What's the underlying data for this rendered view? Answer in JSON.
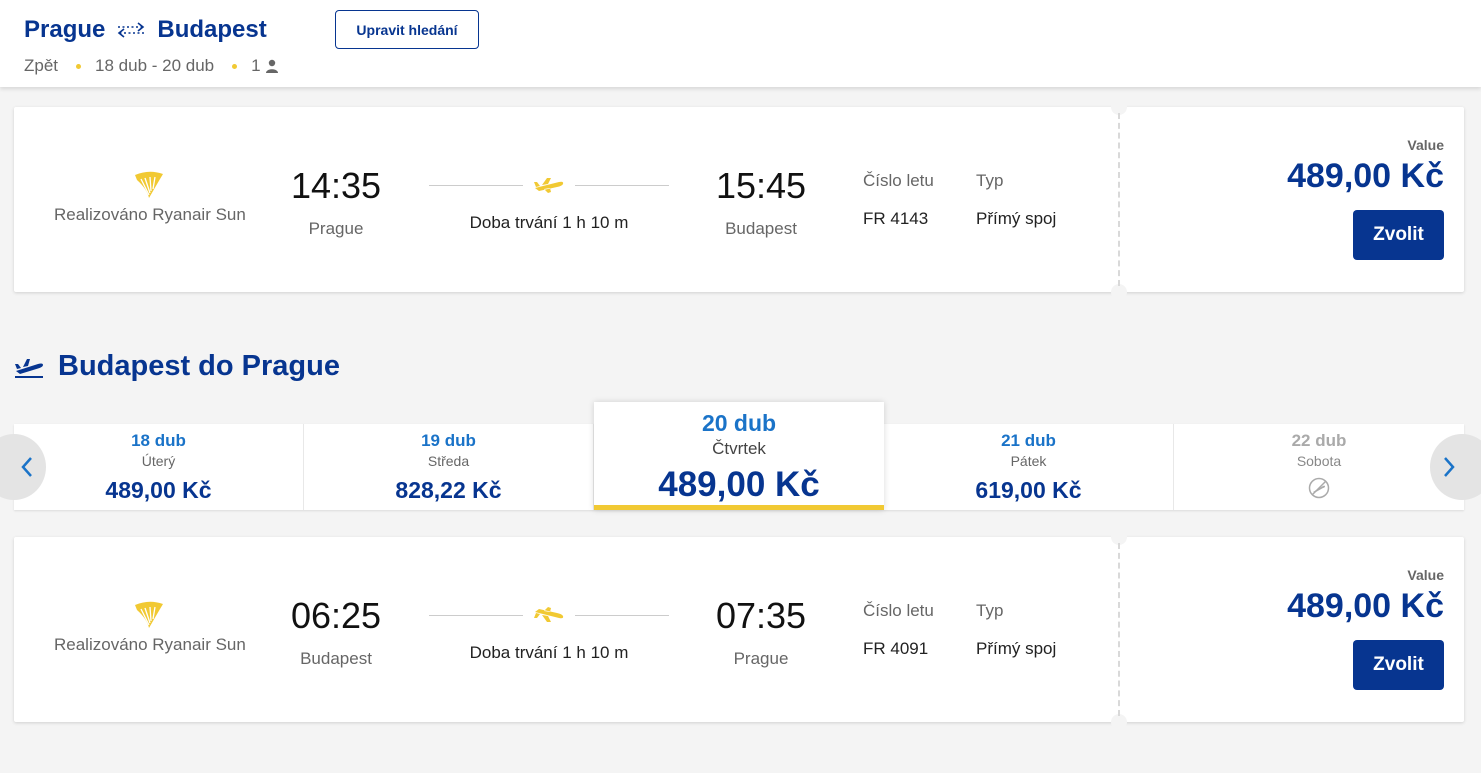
{
  "header": {
    "origin": "Prague",
    "destination": "Budapest",
    "back_label": "Zpět",
    "dates": "18 dub - 20 dub",
    "passengers": "1",
    "edit_button": "Upravit hledání"
  },
  "outbound_flight": {
    "operator": "Realizováno Ryanair Sun",
    "departure_time": "14:35",
    "departure_city": "Prague",
    "duration": "Doba trvání 1 h 10 m",
    "arrival_time": "15:45",
    "arrival_city": "Budapest",
    "flight_number_label": "Číslo letu",
    "flight_number": "FR 4143",
    "type_label": "Typ",
    "type": "Přímý spoj",
    "fare_label": "Value",
    "price": "489,00 Kč",
    "select_button": "Zvolit"
  },
  "return_section": {
    "title": "Budapest do Prague"
  },
  "date_carousel": [
    {
      "date": "18 dub",
      "day": "Úterý",
      "price": "489,00 Kč"
    },
    {
      "date": "19 dub",
      "day": "Středa",
      "price": "828,22 Kč"
    },
    {
      "date": "20 dub",
      "day": "Čtvrtek",
      "price": "489,00 Kč"
    },
    {
      "date": "21 dub",
      "day": "Pátek",
      "price": "619,00 Kč"
    },
    {
      "date": "22 dub",
      "day": "Sobota",
      "price": ""
    }
  ],
  "return_flight": {
    "operator": "Realizováno Ryanair Sun",
    "departure_time": "06:25",
    "departure_city": "Budapest",
    "duration": "Doba trvání 1 h 10 m",
    "arrival_time": "07:35",
    "arrival_city": "Prague",
    "flight_number_label": "Číslo letu",
    "flight_number": "FR 4091",
    "type_label": "Typ",
    "type": "Přímý spoj",
    "fare_label": "Value",
    "price": "489,00 Kč",
    "select_button": "Zvolit"
  },
  "colors": {
    "brand_blue": "#073590",
    "accent_yellow": "#f1c933",
    "link_blue": "#1a73c8"
  },
  "icons": [
    "round-trip-arrows-icon",
    "person-icon",
    "ryanair-harp-logo",
    "plane-icon",
    "departure-plane-icon",
    "chevron-left-icon",
    "chevron-right-icon",
    "no-flight-icon"
  ]
}
